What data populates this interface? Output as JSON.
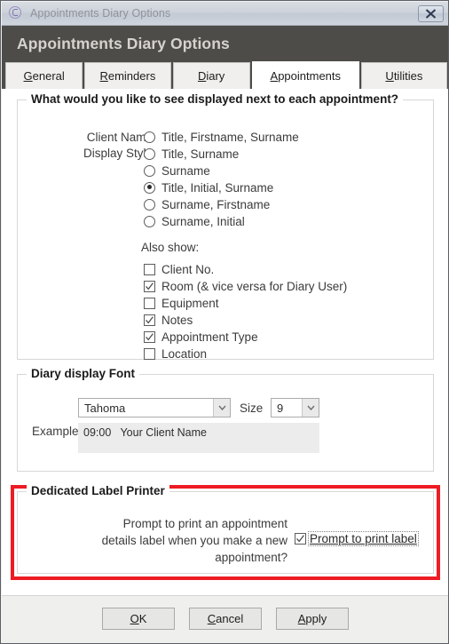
{
  "window": {
    "title": "Appointments Diary Options",
    "app_icon": "circle-p-icon",
    "close_label": "close-icon"
  },
  "banner": {
    "title": "Appointments Diary Options"
  },
  "tabs": [
    {
      "label": "General",
      "accel": "G",
      "active": false
    },
    {
      "label": "Reminders",
      "accel": "R",
      "active": false
    },
    {
      "label": "Diary",
      "accel": "D",
      "active": false
    },
    {
      "label": "Appointments",
      "accel": "A",
      "active": true
    },
    {
      "label": "Utilities",
      "accel": "U",
      "active": false
    }
  ],
  "display_group": {
    "legend": "What would you like to see displayed next to each appointment?",
    "client_name_label_line1": "Client Name",
    "client_name_label_line2": "Display Style",
    "radios": [
      {
        "label": "Title, Firstname, Surname",
        "selected": false
      },
      {
        "label": "Title, Surname",
        "selected": false
      },
      {
        "label": "Surname",
        "selected": false
      },
      {
        "label": "Title, Initial, Surname",
        "selected": true
      },
      {
        "label": "Surname, Firstname",
        "selected": false
      },
      {
        "label": "Surname, Initial",
        "selected": false
      }
    ],
    "also_show_label": "Also show:",
    "checkboxes": [
      {
        "label": "Client No.",
        "checked": false
      },
      {
        "label": "Room (& vice versa for Diary User)",
        "checked": true
      },
      {
        "label": "Equipment",
        "checked": false
      },
      {
        "label": "Notes",
        "checked": true
      },
      {
        "label": "Appointment Type",
        "checked": true
      },
      {
        "label": "Location",
        "checked": false
      }
    ]
  },
  "font_group": {
    "legend": "Diary display Font",
    "font_value": "Tahoma",
    "size_label": "Size",
    "size_value": "9",
    "example_label": "Example",
    "example_value": "09:00   Your Client Name"
  },
  "printer_group": {
    "legend": "Dedicated Label Printer",
    "prompt_line1": "Prompt to print an appointment",
    "prompt_line2": "details label when you make a new",
    "prompt_line3": "appointment?",
    "checkbox_label": "Prompt to print label",
    "checkbox_checked": true,
    "highlight_color": "#ed1c24"
  },
  "footer": {
    "buttons": [
      {
        "label": "OK",
        "accel": "O"
      },
      {
        "label": "Cancel",
        "accel": "C"
      },
      {
        "label": "Apply",
        "accel": "A"
      }
    ]
  }
}
